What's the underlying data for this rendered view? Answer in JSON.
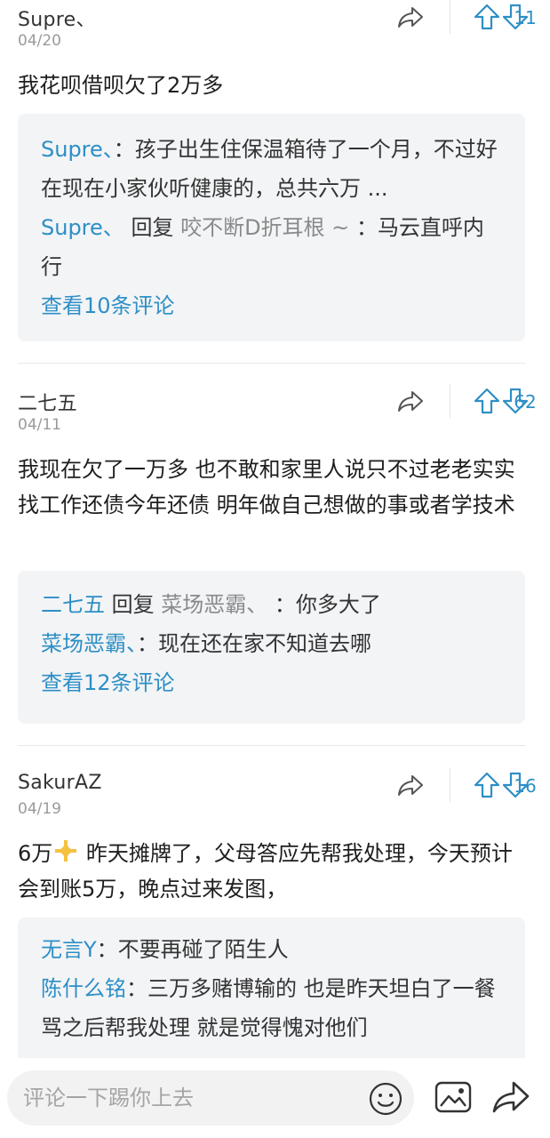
{
  "comments": [
    {
      "author": "Supre、",
      "date": "04/20",
      "votes": "11",
      "text": "我花呗借呗欠了2万多",
      "replies": [
        {
          "name": "Supre、",
          "sep": "：",
          "text": "孩子出生住保温箱待了一个月，不过好在现在小家伙听健康的，总共六万 ..."
        },
        {
          "name": "Supre、",
          "reply_word": "回复",
          "target": "咬不断D折耳根 ~",
          "sep": "：",
          "text": "马云直呼内行"
        }
      ],
      "view_more": "查看10条评论"
    },
    {
      "author": "二七五",
      "date": "04/11",
      "votes": "62",
      "text": "我现在欠了一万多  也不敢和家里人说只不过老老实实找工作还债今年还债 明年做自己想做的事或者学技术",
      "replies": [
        {
          "name": "二七五",
          "reply_word": "回复",
          "target": "菜场恶霸、",
          "sep": "：",
          "text": "你多大了"
        },
        {
          "name": "菜场恶霸、",
          "sep": "：",
          "text": "现在还在家不知道去哪"
        }
      ],
      "view_more": "查看12条评论"
    },
    {
      "author": "SakurAZ",
      "date": "04/19",
      "votes": "16",
      "text_before": "6万",
      "text_emoji": "sparkle-plus-icon",
      "text_after": " 昨天摊牌了，父母答应先帮我处理，今天预计会到账5万，晚点过来发图，",
      "replies": [
        {
          "name": "无言Y",
          "sep": "：",
          "text": "不要再碰了陌生人"
        },
        {
          "name": "陈什么铭",
          "sep": "：",
          "text": "三万多赌博输的 也是昨天坦白了一餐骂之后帮我处理 就是觉得愧对他们"
        }
      ]
    }
  ],
  "bottom_bar": {
    "placeholder": "评论一下踢你上去"
  },
  "colors": {
    "accent": "#2d8fc6",
    "reply_bg": "#f3f4f6",
    "muted": "#9a9a9a"
  },
  "icons": [
    "share-icon",
    "upvote-arrow-icon",
    "downvote-arrow-icon",
    "emoji-icon",
    "image-icon",
    "share-bottom-icon"
  ]
}
